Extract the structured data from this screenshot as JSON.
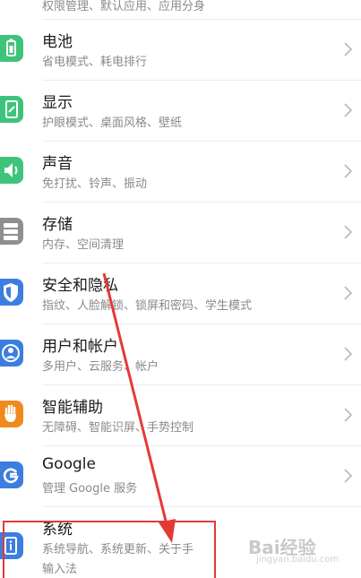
{
  "settings": {
    "top_partial": {
      "subtitle": "权限管理、默认应用、应用分身"
    },
    "items": [
      {
        "title": "电池",
        "subtitle": "省电模式、耗电排行",
        "icon": "battery-icon",
        "color": "#3ec47a"
      },
      {
        "title": "显示",
        "subtitle": "护眼模式、桌面风格、壁纸",
        "icon": "display-icon",
        "color": "#3ec47a"
      },
      {
        "title": "声音",
        "subtitle": "免打扰、铃声、振动",
        "icon": "sound-icon",
        "color": "#3ec47a"
      },
      {
        "title": "存储",
        "subtitle": "内存、空间清理",
        "icon": "storage-icon",
        "color": "#8f8f8f"
      },
      {
        "title": "安全和隐私",
        "subtitle": "指纹、人脸解锁、锁屏和密码、学生模式",
        "icon": "shield-icon",
        "color": "#3c7ee0"
      },
      {
        "title": "用户和帐户",
        "subtitle": "多用户、云服务、帐户",
        "icon": "user-icon",
        "color": "#3c7ee0"
      },
      {
        "title": "智能辅助",
        "subtitle": "无障碍、智能识屏、手势控制",
        "icon": "hand-icon",
        "color": "#f08a1e"
      },
      {
        "title": "Google",
        "subtitle": "管理 Google 服务",
        "icon": "google-icon",
        "color": "#3c7ee0"
      },
      {
        "title": "系统",
        "subtitle": "系统导航、系统更新、关于手",
        "subtitle2": "输入法",
        "icon": "info-icon",
        "color": "#3c7ee0"
      }
    ]
  },
  "watermark": {
    "text": "Bai经验",
    "sub": "jingyan.baidu.com"
  }
}
